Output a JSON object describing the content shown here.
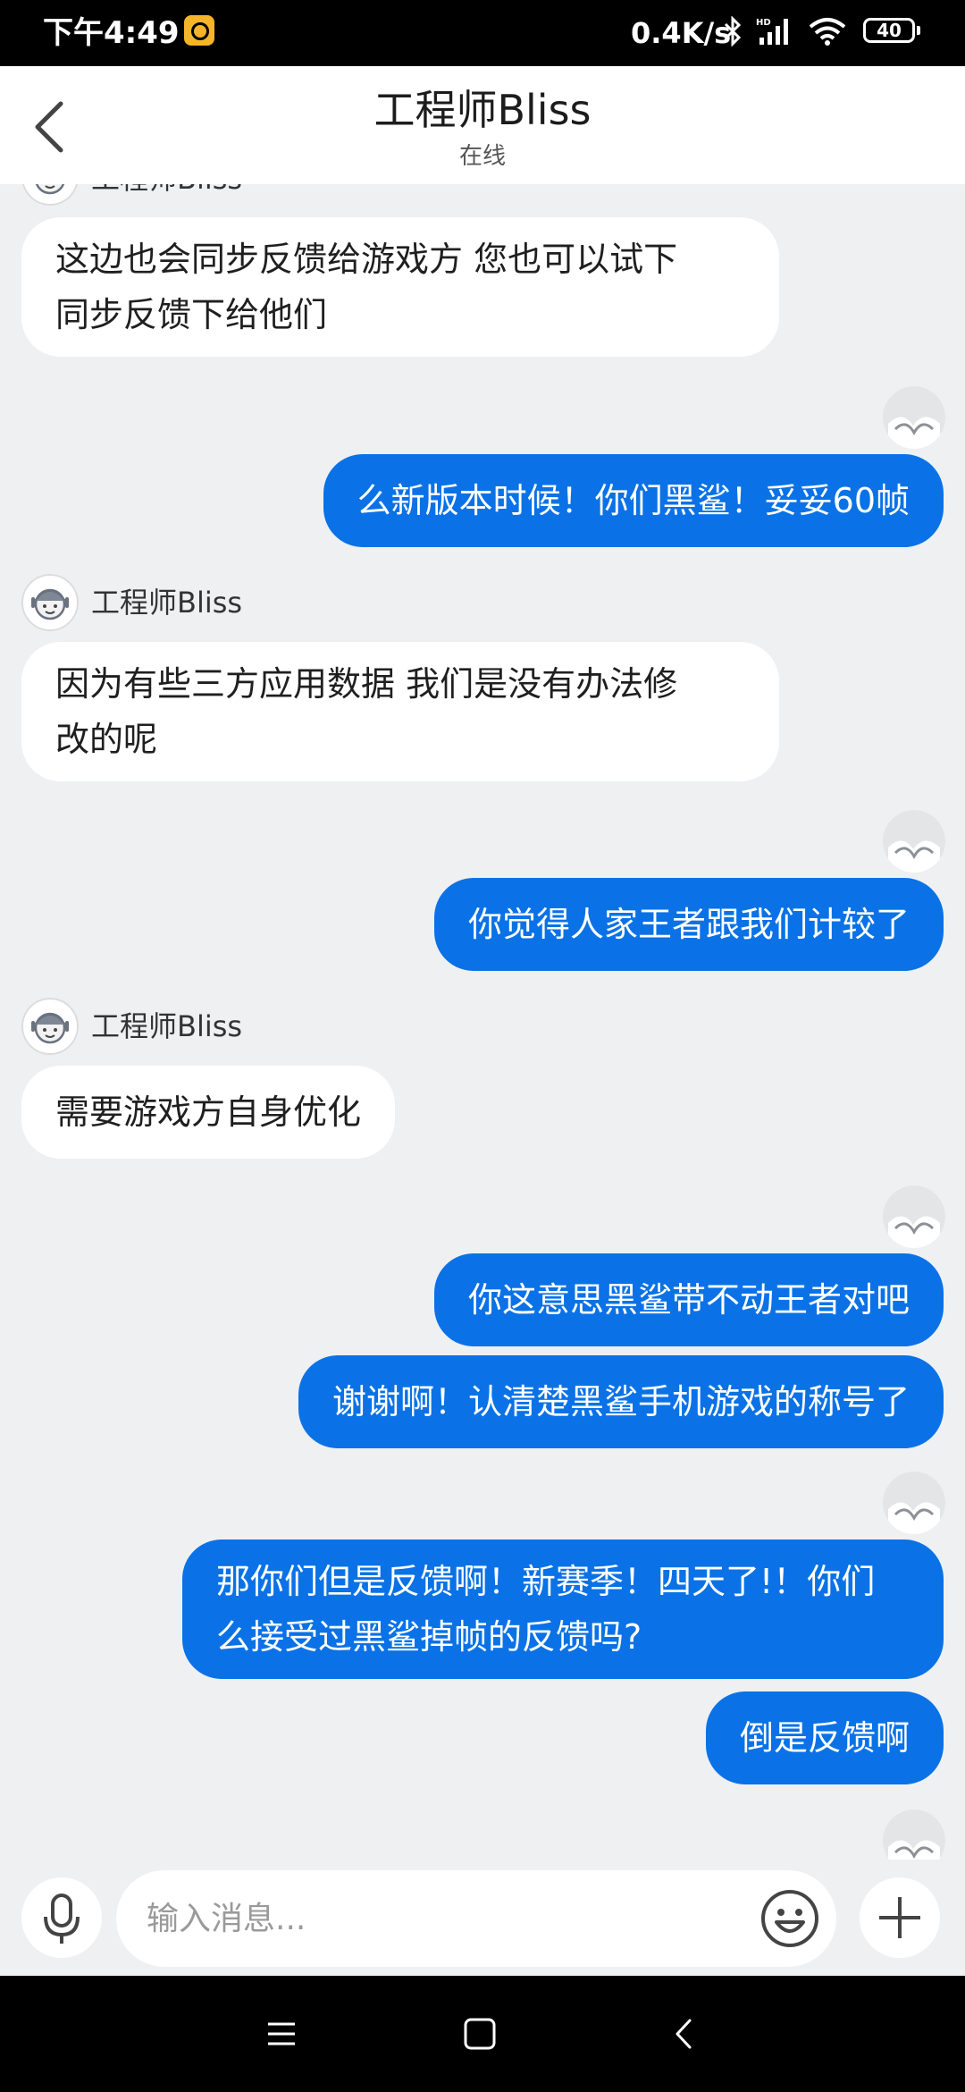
{
  "status_bar": {
    "time": "下午4:49",
    "network_speed": "0.4K/s",
    "battery_level": "40",
    "icons": [
      "app-notification-icon",
      "bluetooth-icon",
      "hd-signal-icon",
      "wifi-icon",
      "battery-icon"
    ]
  },
  "header": {
    "title": "工程师Bliss",
    "subtitle": "在线"
  },
  "messages": [
    {
      "from": "agent",
      "sender": "工程师Bliss",
      "text": "这边也会同步反馈给游戏方  您也可以试下同步反馈下给他们",
      "partial": true
    },
    {
      "from": "me",
      "text": "么新版本时候！你们黑鲨！妥妥60帧"
    },
    {
      "from": "agent",
      "sender": "工程师Bliss",
      "text": "因为有些三方应用数据 我们是没有办法修改的呢"
    },
    {
      "from": "me",
      "text": "你觉得人家王者跟我们计较了"
    },
    {
      "from": "agent",
      "sender": "工程师Bliss",
      "text": "需要游戏方自身优化"
    },
    {
      "from": "me",
      "text": "你这意思黑鲨带不动王者对吧"
    },
    {
      "from": "me",
      "text": "谢谢啊！认清楚黑鲨手机游戏的称号了"
    },
    {
      "from": "me",
      "text": "那你们但是反馈啊！新赛季！四天了!！你们么接受过黑鲨掉帧的反馈吗?"
    },
    {
      "from": "me",
      "text": "倒是反馈啊"
    }
  ],
  "lines": {
    "m0_l1": "这边也会同步反馈给游戏方  您也可以试下",
    "m0_l2": "同步反馈下给他们",
    "m2_l1": "因为有些三方应用数据 我们是没有办法修",
    "m2_l2": "改的呢",
    "m7_l1": "那你们但是反馈啊！新赛季！四天了!！你们",
    "m7_l2": "么接受过黑鲨掉帧的反馈吗?"
  },
  "input": {
    "placeholder": "输入消息..."
  },
  "colors": {
    "outgoing_bubble": "#0a72e6",
    "incoming_bubble": "#ffffff",
    "chat_background": "#eff0f2",
    "header_background": "#ffffff"
  }
}
